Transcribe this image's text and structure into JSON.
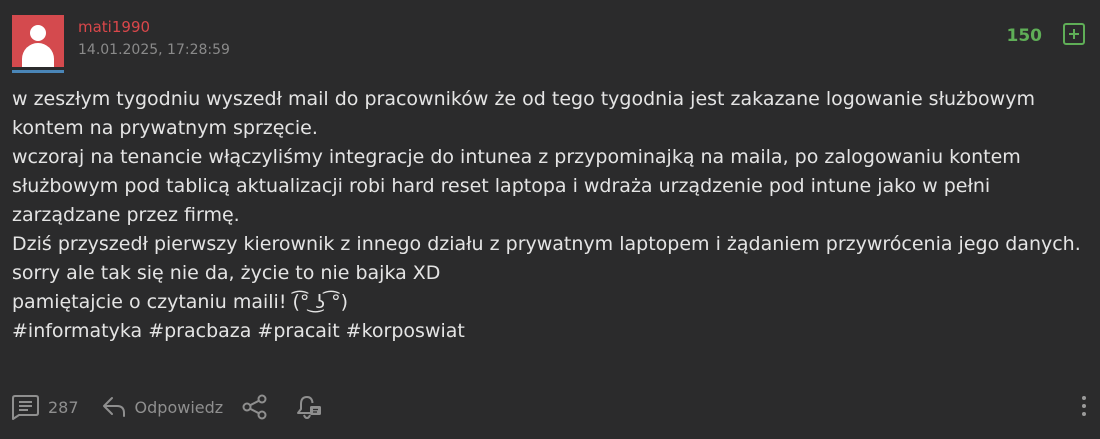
{
  "post": {
    "author": "mati1990",
    "timestamp": "14.01.2025, 17:28:59",
    "votes": "150",
    "lines": [
      "w zeszłym tygodniu wyszedł mail do pracowników że od tego tygodnia jest zakazane logowanie służbowym kontem na prywatnym sprzęcie.",
      "wczoraj na tenancie włączyliśmy integracje do intunea z przypominajką na maila, po zalogowaniu kontem służbowym pod tablicą aktualizacji robi hard reset laptopa i wdraża urządzenie pod intune jako w pełni zarządzane przez firmę.",
      "Dziś przyszedł pierwszy kierownik z innego działu z prywatnym laptopem i żądaniem przywrócenia jego danych.",
      "sorry ale tak się nie da, życie to nie bajka XD",
      "pamiętajcie o czytaniu maili! (͡° ͜ʖ ͡°)"
    ],
    "tags": [
      "#informatyka",
      "#pracbaza",
      "#pracait",
      "#korposwiat"
    ]
  },
  "footer": {
    "comments_count": "287",
    "reply_label": "Odpowiedz"
  },
  "icons": {
    "avatar": "user-silhouette-icon",
    "plus": "plus-icon",
    "comments": "comments-icon",
    "reply": "reply-arrow-icon",
    "share": "share-icon",
    "notify": "bell-icon",
    "more": "more-vertical-icon"
  },
  "colors": {
    "background": "#2b2b2c",
    "author": "#d9474a",
    "votes": "#5fae57",
    "avatar_bg": "#d44a4e",
    "avatar_bar": "#4a86b8",
    "muted": "#8f8f8f"
  }
}
